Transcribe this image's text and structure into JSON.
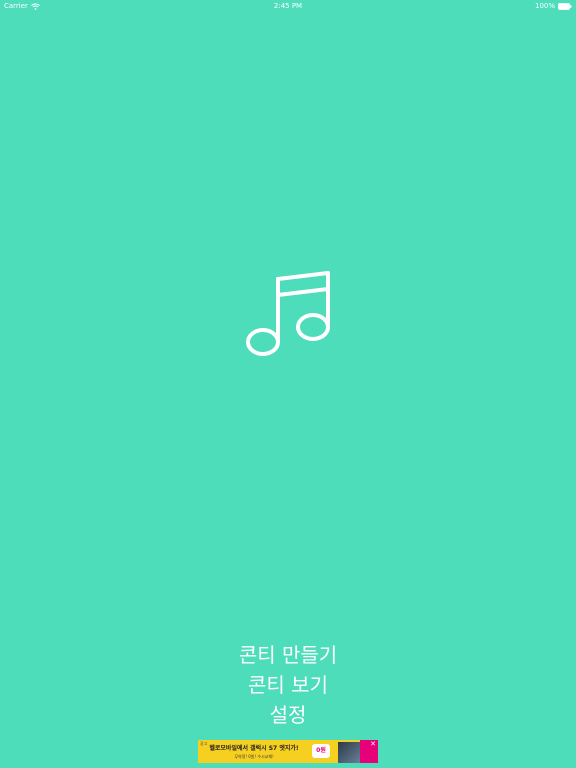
{
  "status_bar": {
    "carrier": "Carrier",
    "time": "2:45 PM",
    "battery": "100%"
  },
  "menu": {
    "items": [
      {
        "label": "콘티 만들기"
      },
      {
        "label": "콘티 보기"
      },
      {
        "label": "설정"
      }
    ]
  },
  "ad": {
    "tag": "광고",
    "headline": "헬로모바일에서 갤럭시 S7 엣지가!",
    "sub": "무약정! 0원! 수시교체!",
    "badge": "0원"
  },
  "colors": {
    "background": "#4DDDBB",
    "foreground": "#FFFFFF",
    "ad_background": "#F5D020",
    "ad_accent": "#E6007A"
  },
  "icons": {
    "center": "music-note-icon",
    "status": [
      "wifi-icon",
      "battery-icon"
    ]
  }
}
